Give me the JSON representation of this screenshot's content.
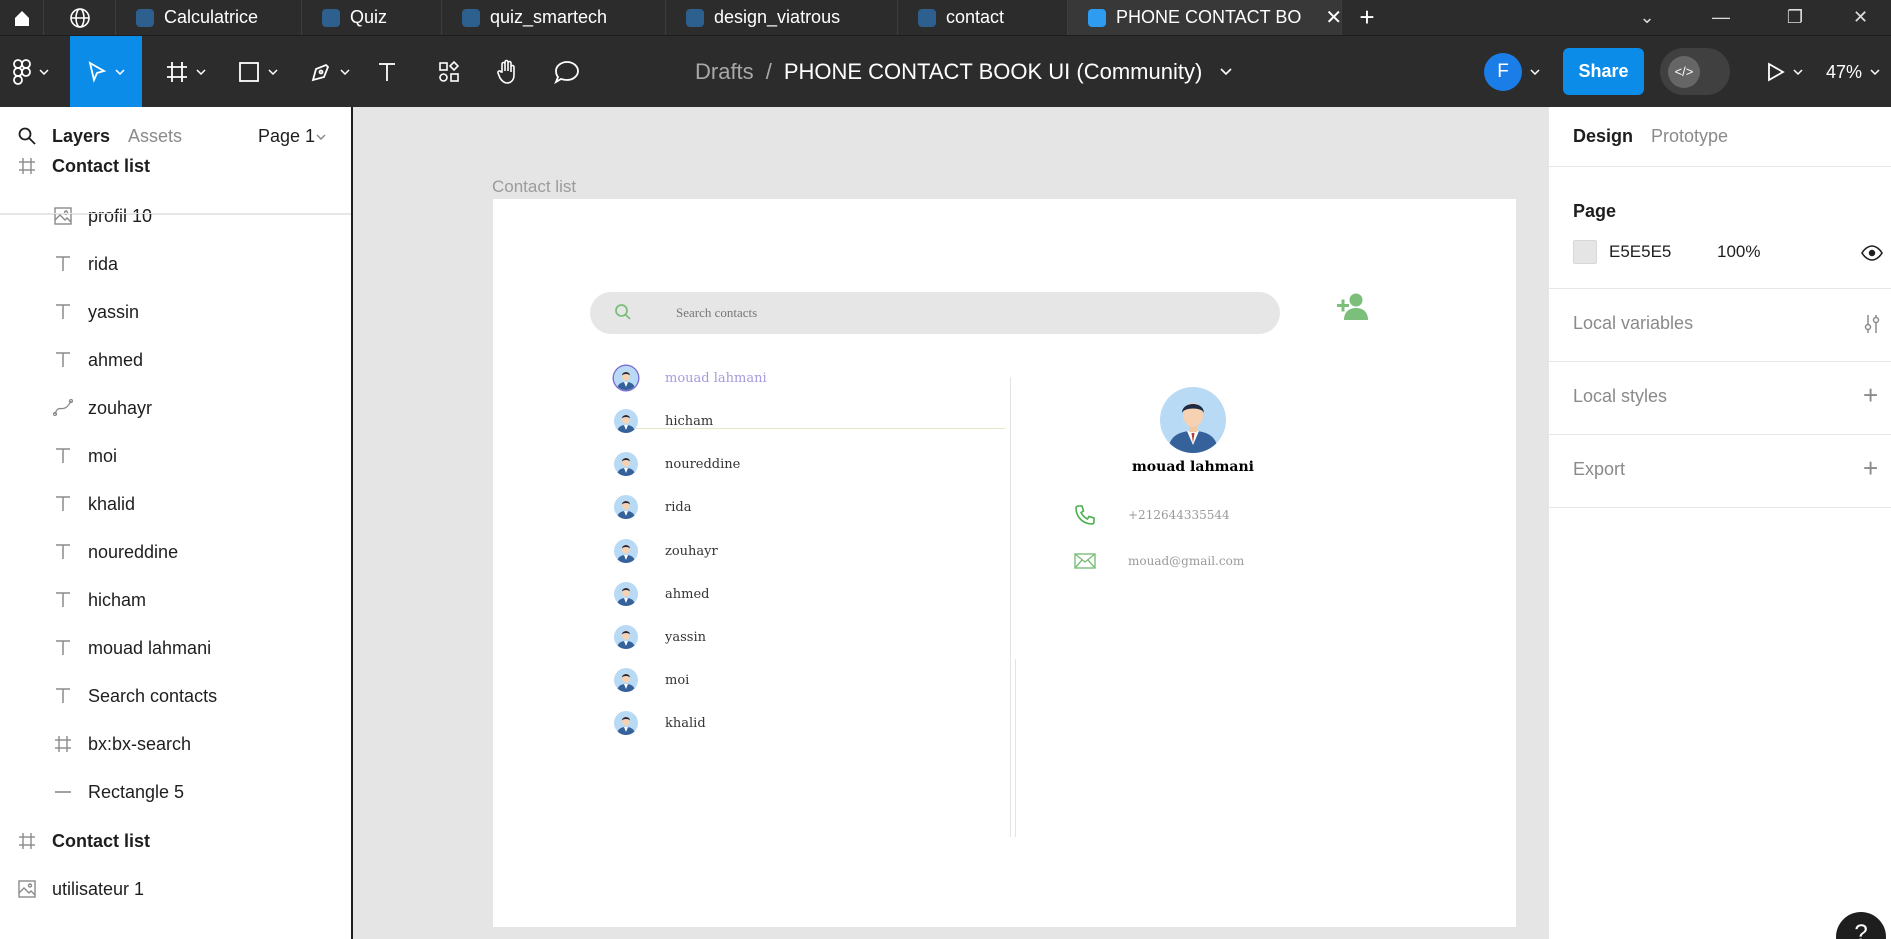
{
  "tabs": [
    {
      "label": "Calculatrice"
    },
    {
      "label": "Quiz"
    },
    {
      "label": "quiz_smartech"
    },
    {
      "label": "design_viatrous"
    },
    {
      "label": "contact"
    },
    {
      "label": "PHONE CONTACT BO"
    }
  ],
  "breadcrumb": {
    "parent": "Drafts",
    "separator": "/",
    "file": "PHONE CONTACT BOOK UI (Community)"
  },
  "toolbar": {
    "user_initial": "F",
    "share_label": "Share",
    "zoom": "47%"
  },
  "left_panel": {
    "tab_layers": "Layers",
    "tab_assets": "Assets",
    "page_selector": "Page 1",
    "layers": [
      {
        "label": "Contact list",
        "icon": "frame-icon"
      },
      {
        "label": "profil 10",
        "icon": "image-icon"
      },
      {
        "label": "rida",
        "icon": "text-icon"
      },
      {
        "label": "yassin",
        "icon": "text-icon"
      },
      {
        "label": "ahmed",
        "icon": "text-icon"
      },
      {
        "label": "zouhayr",
        "icon": "vector-icon"
      },
      {
        "label": "moi",
        "icon": "text-icon"
      },
      {
        "label": "khalid",
        "icon": "text-icon"
      },
      {
        "label": "noureddine",
        "icon": "text-icon"
      },
      {
        "label": "hicham",
        "icon": "text-icon"
      },
      {
        "label": "mouad lahmani",
        "icon": "text-icon"
      },
      {
        "label": "Search contacts",
        "icon": "text-icon"
      },
      {
        "label": "bx:bx-search",
        "icon": "frame-icon"
      },
      {
        "label": "Rectangle 5",
        "icon": "line-icon"
      },
      {
        "label": "Contact list",
        "icon": "frame-icon"
      },
      {
        "label": "utilisateur 1",
        "icon": "image-icon"
      }
    ]
  },
  "canvas": {
    "frame_label": "Contact list",
    "search_placeholder": "Search contacts",
    "contacts": [
      {
        "name": "mouad lahmani",
        "selected": true
      },
      {
        "name": "hicham"
      },
      {
        "name": "noureddine"
      },
      {
        "name": "rida"
      },
      {
        "name": "zouhayr"
      },
      {
        "name": "ahmed"
      },
      {
        "name": "yassin"
      },
      {
        "name": "moi"
      },
      {
        "name": "khalid"
      }
    ],
    "detail": {
      "name": "mouad lahmani",
      "phone": "+212644335544",
      "email": "mouad@gmail.com"
    },
    "colors": {
      "accent_green": "#7bbf7b",
      "selected_name": "#a69be0",
      "frame_bg": "#ffffff",
      "canvas_bg": "#e5e5e5"
    }
  },
  "right_panel": {
    "tab_design": "Design",
    "tab_prototype": "Prototype",
    "page_title": "Page",
    "page_color": "E5E5E5",
    "page_opacity": "100%",
    "local_variables": "Local variables",
    "local_styles": "Local styles",
    "export": "Export"
  },
  "help_label": "?"
}
